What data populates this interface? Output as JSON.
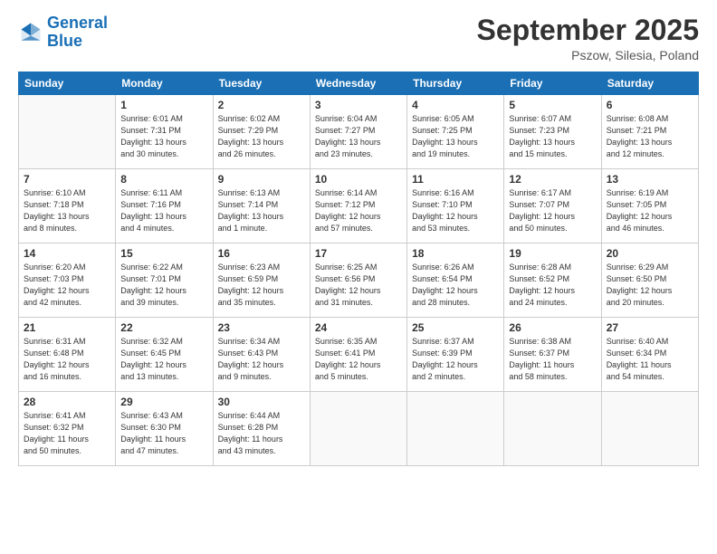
{
  "logo": {
    "line1": "General",
    "line2": "Blue"
  },
  "title": "September 2025",
  "subtitle": "Pszow, Silesia, Poland",
  "header_days": [
    "Sunday",
    "Monday",
    "Tuesday",
    "Wednesday",
    "Thursday",
    "Friday",
    "Saturday"
  ],
  "weeks": [
    [
      {
        "day": "",
        "info": ""
      },
      {
        "day": "1",
        "info": "Sunrise: 6:01 AM\nSunset: 7:31 PM\nDaylight: 13 hours\nand 30 minutes."
      },
      {
        "day": "2",
        "info": "Sunrise: 6:02 AM\nSunset: 7:29 PM\nDaylight: 13 hours\nand 26 minutes."
      },
      {
        "day": "3",
        "info": "Sunrise: 6:04 AM\nSunset: 7:27 PM\nDaylight: 13 hours\nand 23 minutes."
      },
      {
        "day": "4",
        "info": "Sunrise: 6:05 AM\nSunset: 7:25 PM\nDaylight: 13 hours\nand 19 minutes."
      },
      {
        "day": "5",
        "info": "Sunrise: 6:07 AM\nSunset: 7:23 PM\nDaylight: 13 hours\nand 15 minutes."
      },
      {
        "day": "6",
        "info": "Sunrise: 6:08 AM\nSunset: 7:21 PM\nDaylight: 13 hours\nand 12 minutes."
      }
    ],
    [
      {
        "day": "7",
        "info": "Sunrise: 6:10 AM\nSunset: 7:18 PM\nDaylight: 13 hours\nand 8 minutes."
      },
      {
        "day": "8",
        "info": "Sunrise: 6:11 AM\nSunset: 7:16 PM\nDaylight: 13 hours\nand 4 minutes."
      },
      {
        "day": "9",
        "info": "Sunrise: 6:13 AM\nSunset: 7:14 PM\nDaylight: 13 hours\nand 1 minute."
      },
      {
        "day": "10",
        "info": "Sunrise: 6:14 AM\nSunset: 7:12 PM\nDaylight: 12 hours\nand 57 minutes."
      },
      {
        "day": "11",
        "info": "Sunrise: 6:16 AM\nSunset: 7:10 PM\nDaylight: 12 hours\nand 53 minutes."
      },
      {
        "day": "12",
        "info": "Sunrise: 6:17 AM\nSunset: 7:07 PM\nDaylight: 12 hours\nand 50 minutes."
      },
      {
        "day": "13",
        "info": "Sunrise: 6:19 AM\nSunset: 7:05 PM\nDaylight: 12 hours\nand 46 minutes."
      }
    ],
    [
      {
        "day": "14",
        "info": "Sunrise: 6:20 AM\nSunset: 7:03 PM\nDaylight: 12 hours\nand 42 minutes."
      },
      {
        "day": "15",
        "info": "Sunrise: 6:22 AM\nSunset: 7:01 PM\nDaylight: 12 hours\nand 39 minutes."
      },
      {
        "day": "16",
        "info": "Sunrise: 6:23 AM\nSunset: 6:59 PM\nDaylight: 12 hours\nand 35 minutes."
      },
      {
        "day": "17",
        "info": "Sunrise: 6:25 AM\nSunset: 6:56 PM\nDaylight: 12 hours\nand 31 minutes."
      },
      {
        "day": "18",
        "info": "Sunrise: 6:26 AM\nSunset: 6:54 PM\nDaylight: 12 hours\nand 28 minutes."
      },
      {
        "day": "19",
        "info": "Sunrise: 6:28 AM\nSunset: 6:52 PM\nDaylight: 12 hours\nand 24 minutes."
      },
      {
        "day": "20",
        "info": "Sunrise: 6:29 AM\nSunset: 6:50 PM\nDaylight: 12 hours\nand 20 minutes."
      }
    ],
    [
      {
        "day": "21",
        "info": "Sunrise: 6:31 AM\nSunset: 6:48 PM\nDaylight: 12 hours\nand 16 minutes."
      },
      {
        "day": "22",
        "info": "Sunrise: 6:32 AM\nSunset: 6:45 PM\nDaylight: 12 hours\nand 13 minutes."
      },
      {
        "day": "23",
        "info": "Sunrise: 6:34 AM\nSunset: 6:43 PM\nDaylight: 12 hours\nand 9 minutes."
      },
      {
        "day": "24",
        "info": "Sunrise: 6:35 AM\nSunset: 6:41 PM\nDaylight: 12 hours\nand 5 minutes."
      },
      {
        "day": "25",
        "info": "Sunrise: 6:37 AM\nSunset: 6:39 PM\nDaylight: 12 hours\nand 2 minutes."
      },
      {
        "day": "26",
        "info": "Sunrise: 6:38 AM\nSunset: 6:37 PM\nDaylight: 11 hours\nand 58 minutes."
      },
      {
        "day": "27",
        "info": "Sunrise: 6:40 AM\nSunset: 6:34 PM\nDaylight: 11 hours\nand 54 minutes."
      }
    ],
    [
      {
        "day": "28",
        "info": "Sunrise: 6:41 AM\nSunset: 6:32 PM\nDaylight: 11 hours\nand 50 minutes."
      },
      {
        "day": "29",
        "info": "Sunrise: 6:43 AM\nSunset: 6:30 PM\nDaylight: 11 hours\nand 47 minutes."
      },
      {
        "day": "30",
        "info": "Sunrise: 6:44 AM\nSunset: 6:28 PM\nDaylight: 11 hours\nand 43 minutes."
      },
      {
        "day": "",
        "info": ""
      },
      {
        "day": "",
        "info": ""
      },
      {
        "day": "",
        "info": ""
      },
      {
        "day": "",
        "info": ""
      }
    ]
  ]
}
